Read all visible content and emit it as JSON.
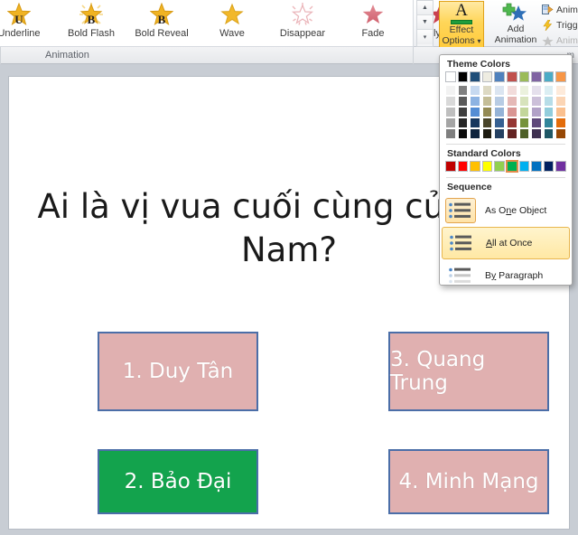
{
  "ribbon": {
    "group_label": "Animation",
    "gallery": [
      {
        "label": "Underline",
        "letter": "U",
        "style": "gold"
      },
      {
        "label": "Bold Flash",
        "letter": "B",
        "style": "gold-burst"
      },
      {
        "label": "Bold Reveal",
        "letter": "B",
        "style": "gold"
      },
      {
        "label": "Wave",
        "letter": "",
        "style": "gold"
      },
      {
        "label": "Disappear",
        "letter": "",
        "style": "pink-outline"
      },
      {
        "label": "Fade",
        "letter": "",
        "style": "red"
      },
      {
        "label": "Fly Out",
        "letter": "",
        "style": "red-lines"
      }
    ],
    "scroll_up_icon": "scroll-up-icon",
    "scroll_down_icon": "scroll-down-icon",
    "scroll_more_icon": "gallery-more-icon",
    "effect_options": {
      "label_line1": "Effect",
      "label_line2": "Options",
      "glyph": "A",
      "accent_color": "#1f9d3c",
      "dropdown_caret": "▾"
    },
    "add_animation": {
      "label_line1": "Add",
      "label_line2": "Animation",
      "dropdown_caret": "▾"
    },
    "right_commands": [
      {
        "label": "Anima",
        "icon": "animation-pane-icon",
        "enabled": true
      },
      {
        "label": "Trigge",
        "icon": "trigger-lightning-icon",
        "enabled": true
      },
      {
        "label": "Anima",
        "icon": "animation-painter-icon",
        "enabled": false
      }
    ],
    "truncated_label": "m"
  },
  "dropdown": {
    "theme_colors_heading": "Theme Colors",
    "standard_colors_heading": "Standard Colors",
    "sequence_heading": "Sequence",
    "theme_top_row": [
      "#ffffff",
      "#000000",
      "#1f4e79",
      "#eeece1",
      "#4f81bd",
      "#c0504d",
      "#9bbb59",
      "#8064a2",
      "#4bacc6",
      "#f79646"
    ],
    "theme_variant_rows": [
      [
        "#f2f2f2",
        "#7f7f7f",
        "#c6d9f0",
        "#ddd9c3",
        "#dbe5f1",
        "#f2dcdb",
        "#ebf1dd",
        "#e5e0ec",
        "#dbeef3",
        "#fdeada"
      ],
      [
        "#d9d9d9",
        "#595959",
        "#8db3e2",
        "#c4bd97",
        "#b8cce4",
        "#e5b9b7",
        "#d7e3bc",
        "#ccc0d9",
        "#b7dde8",
        "#fbd5b5"
      ],
      [
        "#bfbfbf",
        "#3f3f3f",
        "#548dd4",
        "#948a54",
        "#95b3d7",
        "#d99694",
        "#c3d69b",
        "#b2a2c7",
        "#92cddc",
        "#fac08f"
      ],
      [
        "#a5a5a5",
        "#262626",
        "#17375e",
        "#494429",
        "#366092",
        "#953734",
        "#76923c",
        "#5f497a",
        "#31859b",
        "#e36c0a"
      ],
      [
        "#7f7f7f",
        "#0c0c0c",
        "#0f243e",
        "#1d1b10",
        "#244061",
        "#632423",
        "#4f6128",
        "#3f3151",
        "#205867",
        "#974806"
      ]
    ],
    "standard_colors": [
      "#c00000",
      "#ff0000",
      "#ffc000",
      "#ffff00",
      "#92d050",
      "#00b050",
      "#00b0f0",
      "#0070c0",
      "#002060",
      "#7030a0"
    ],
    "standard_selected_index": 5,
    "sequence_items": [
      {
        "label": "As One Object",
        "accel": "n",
        "state": "boxed"
      },
      {
        "label": "All at Once",
        "accel": "A",
        "state": "highlighted"
      },
      {
        "label": "By Paragraph",
        "accel": "y",
        "state": "normal"
      }
    ]
  },
  "slide": {
    "title": "Ai là vị vua cuối cùng của Việt Nam?",
    "answers": [
      {
        "label": "1. Duy Tân",
        "fill": "#e0b0b0",
        "border": "#4b6ea8",
        "kind": "pink"
      },
      {
        "label": "3. Quang Trung",
        "fill": "#e0b0b0",
        "border": "#4b6ea8",
        "kind": "pink"
      },
      {
        "label": "2. Bảo Đại",
        "fill": "#13a34d",
        "border": "#4b6ea8",
        "kind": "green"
      },
      {
        "label": "4. Minh Mạng",
        "fill": "#e0b0b0",
        "border": "#4b6ea8",
        "kind": "pink"
      }
    ]
  }
}
